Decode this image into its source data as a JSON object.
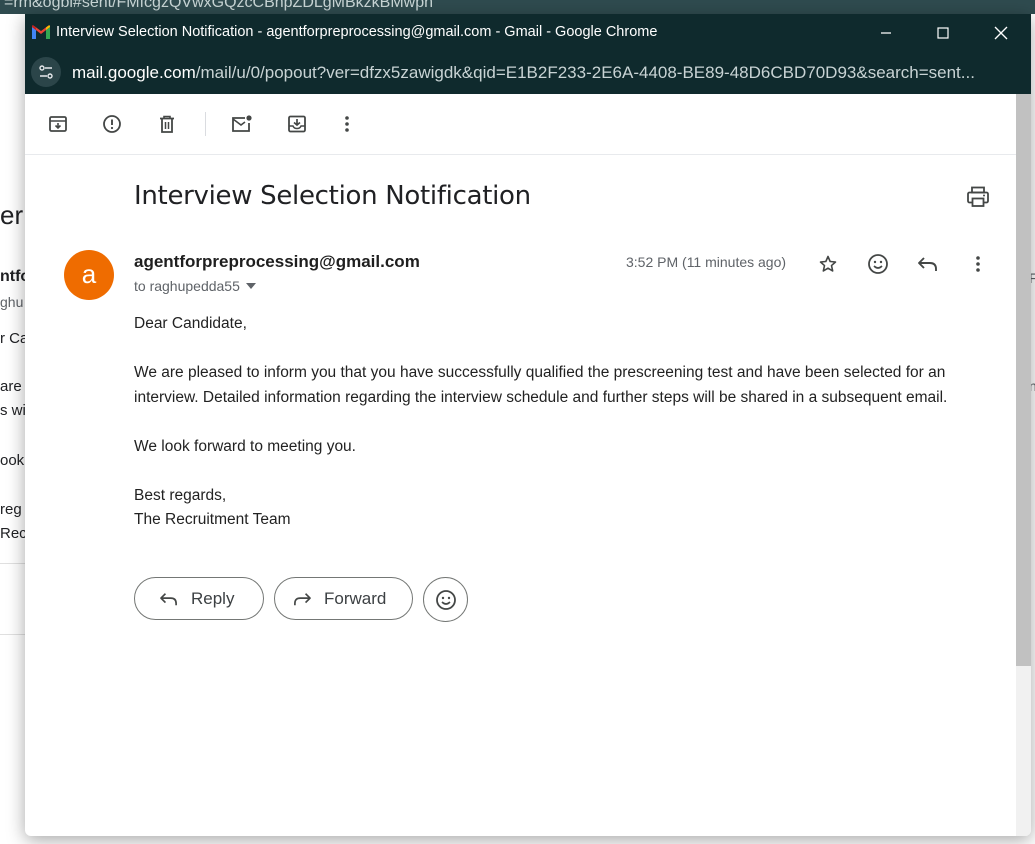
{
  "background": {
    "url_fragment": "=rm&ogbl#sent/FMfcgzQVwxGQzcCBnpZDLgMBkzkBMwpn",
    "fragments": [
      "er",
      "ntfo",
      "ghu",
      "r Ca",
      "are p",
      "s wi",
      "ook",
      "reg",
      "Rec",
      "F",
      "n"
    ]
  },
  "window": {
    "title": "Interview Selection Notification - agentforpreprocessing@gmail.com - Gmail - Google Chrome",
    "url_host": "mail.google.com",
    "url_path": "/mail/u/0/popout?ver=dfzx5zawigdk&qid=E1B2F233-2E6A-4408-BE89-48D6CBD70D93&search=sent...",
    "gmail_logo_colors": [
      "#4285f4",
      "#ea4335",
      "#fbbc04",
      "#34a853",
      "#c5221f"
    ]
  },
  "toolbar": {
    "icons": [
      "archive-icon",
      "report-spam-icon",
      "delete-icon",
      "mark-unread-icon",
      "move-to-icon",
      "more-vert-icon"
    ]
  },
  "message": {
    "subject": "Interview Selection Notification",
    "avatar_letter": "a",
    "avatar_color": "#ef6c00",
    "sender": "agentforpreprocessing@gmail.com",
    "to_line": "to raghupedda55",
    "timestamp": "3:52 PM (11 minutes ago)",
    "body": {
      "greeting": "Dear Candidate,",
      "paragraph1": "We are pleased to inform you that you have successfully qualified the prescreening test and have been selected for an interview. Detailed information regarding the interview schedule and further steps will be shared in a subsequent email.",
      "paragraph2": "We look forward to meeting you.",
      "closing": "Best regards,",
      "signature": "The Recruitment Team"
    }
  },
  "actions": {
    "reply_label": "Reply",
    "forward_label": "Forward"
  }
}
